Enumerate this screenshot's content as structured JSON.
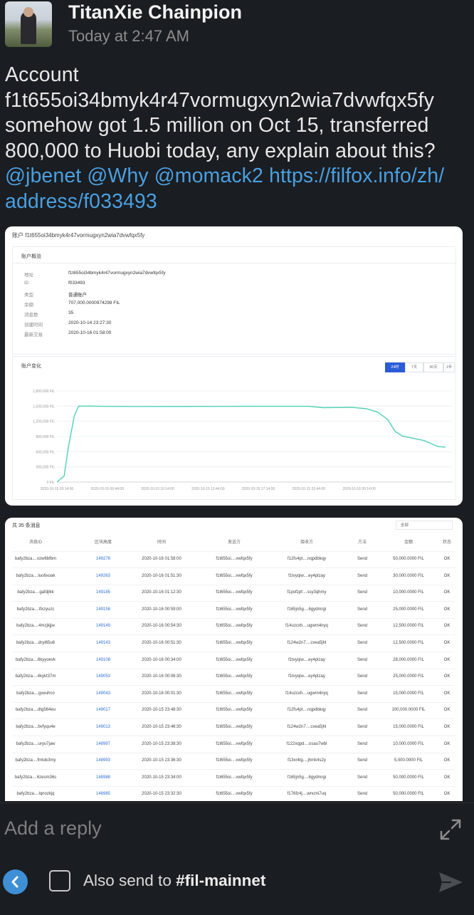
{
  "message": {
    "sender": "TitanXie Chainpion",
    "timestamp": "Today at 2:47 AM",
    "lines": [
      "Account",
      "f1t655oi34bmyk4r47vormugxyn2wia7dvwfqx5fy",
      "somehow got 1.5 million on Oct 15, transferred",
      "800,000 to Huobi today, any explain about this?"
    ],
    "mentions": [
      "@jbenet",
      "@Why",
      "@momack2"
    ],
    "link_part1": "https://filfox.info/zh/",
    "link_part2": "address/f033493"
  },
  "screenshot": {
    "title": "账户 f1t655oi34bmyk4r47vormugxyn2wia7dvwfqx5fy",
    "overview": {
      "heading": "账户概览",
      "rows": [
        {
          "key": "地址",
          "value": "f1t655oi34bmyk4r47vormugxyn2wia7dvwfqx5fy"
        },
        {
          "key": "ID",
          "value": "f033493"
        },
        {
          "key": "类型",
          "value": "普通账户"
        },
        {
          "key": "余额",
          "value": "707,000.0000974298 FIL"
        },
        {
          "key": "消息数",
          "value": "35"
        },
        {
          "key": "创建时间",
          "value": "2020-10-14 23:27:30"
        },
        {
          "key": "最新交易",
          "value": "2020-10-16 01:58:00"
        }
      ]
    },
    "chart_panel": {
      "heading": "账户变化",
      "ranges": [
        "24时",
        "7天",
        "30天",
        "1年"
      ],
      "active_range": "24时"
    },
    "table": {
      "title": "共 35 条消息",
      "filter": "全部",
      "headers": [
        "消息ID",
        "区块高度",
        "时间",
        "发送方",
        "接收方",
        "方法",
        "金额",
        "状态"
      ],
      "rows": [
        [
          "bafy2bza....vzw6bfbm",
          "149276",
          "2020-10-16 01:58:00",
          "f1t655oi....vwfqx5fy",
          "f12fs4pt....nqpdbkqy",
          "Send",
          "50,000.0000 FIL",
          "OK"
        ],
        [
          "bafy2bza....luo6xoak",
          "149263",
          "2020-10-16 01:51:30",
          "f1t655oi....vwfqx5fy",
          "f1tvyqiw....ey4plzay",
          "Send",
          "30,000.0000 FIL",
          "OK"
        ],
        [
          "bafy2bza....gafdjlkk",
          "149185",
          "2020-10-16 01:12:30",
          "f1t655oi....vwfqx5fy",
          "f1pofzpf....ssy3qhmy",
          "Send",
          "10,000.0000 FIL",
          "OK"
        ],
        [
          "bafy2bza....tfxzyuzc",
          "149158",
          "2020-10-16 00:59:00",
          "f1t655oi....vwfqx5fy",
          "f165jn5g....6gydmrgi",
          "Send",
          "25,000.0000 FIL",
          "OK"
        ],
        [
          "bafy2bza....4mzjkjjw",
          "149149",
          "2020-10-16 00:54:30",
          "f1t655oi....vwfqx5fy",
          "f14uzcxh....ugwm4nyq",
          "Send",
          "12,500.0000 FIL",
          "OK"
        ],
        [
          "bafy2bza....dryi65u6",
          "149143",
          "2020-10-16 00:51:30",
          "f1t655oi....vwfqx5fy",
          "f124w2n7....cxea5jhl",
          "Send",
          "12,500.0000 FIL",
          "OK"
        ],
        [
          "bafy2bza....6kyyoevk",
          "149108",
          "2020-10-16 00:34:00",
          "f1t655oi....vwfqx5fy",
          "f1tvyqiw....ey4plzay",
          "Send",
          "28,000.0000 FIL",
          "OK"
        ],
        [
          "bafy2bza....4kykt37m",
          "149053",
          "2020-10-16 00:06:30",
          "f1t655oi....vwfqx5fy",
          "f1tvyqiw....ey4plzay",
          "Send",
          "25,000.0000 FIL",
          "OK"
        ],
        [
          "bafy2bza....gxeuhco",
          "149043",
          "2020-10-16 00:01:30",
          "f1t655oi....vwfqx5fy",
          "f14uzcxh....ugwm4nyq",
          "Send",
          "15,000.0000 FIL",
          "OK"
        ],
        [
          "bafy2bza....dtg564eu",
          "149017",
          "2020-10-15 23:48:30",
          "f1t655oi....vwfqx5fy",
          "f12fs4pt....nqpdbkqy",
          "Send",
          "100,000.0000 FIL",
          "OK"
        ],
        [
          "bafy2bza....bvfyqu4e",
          "149013",
          "2020-10-15 23:46:30",
          "f1t655oi....vwfqx5fy",
          "f124w2n7....cxea5jhl",
          "Send",
          "15,000.0000 FIL",
          "OK"
        ],
        [
          "bafy2bza....uryu7jaw",
          "148997",
          "2020-10-15 23:38:30",
          "f1t655oi....vwfqx5fy",
          "f122xqpd....osau7wbl",
          "Send",
          "10,000.0000 FIL",
          "OK"
        ],
        [
          "bafy2bza....fmtok3my",
          "148993",
          "2020-10-15 23:36:30",
          "f1t655oi....vwfqx5fy",
          "f13xr4tg....jhmk4s2y",
          "Send",
          "5,000.0000 FIL",
          "OK"
        ],
        [
          "bafy2bza....6zesm36s",
          "148988",
          "2020-10-15 23:34:00",
          "f1t655oi....vwfqx5fy",
          "f165jn5g....6gydmrgi",
          "Send",
          "50,000.0000 FIL",
          "OK"
        ],
        [
          "bafy2bza....lqnozkjq",
          "148985",
          "2020-10-15 23:32:30",
          "f1t655oi....vwfqx5fy",
          "f176fz4j....wncmi7uq",
          "Send",
          "50,000.0000 FIL",
          "OK"
        ]
      ]
    }
  },
  "chart_data": {
    "type": "line",
    "title": "账户变化",
    "y_tick_labels": [
      "0 FIL",
      "300,000 FIL",
      "600,000 FIL",
      "900,000 FIL",
      "1,200,000 FIL",
      "1,500,000 FIL",
      "1,800,000 FIL"
    ],
    "x_tick_labels": [
      "2020-10-15 03:14:00",
      "2020-10-15 06:44:00",
      "2020-10-15 10:14:00",
      "2020-10-15 13:44:00",
      "2020-10-15 17:14:00",
      "2020-10-15 20:44:00",
      "2020-10-16 00:14:00"
    ],
    "ylim": [
      0,
      1800000
    ],
    "x_hours": [
      0,
      0.5,
      0.8,
      1.2,
      1.5,
      2.3,
      3.5,
      7,
      10.5,
      14,
      17.5,
      18.5,
      20.5,
      21.5,
      22.3,
      23.0,
      23.5,
      24.0,
      24.5,
      25.0,
      25.5,
      26.0,
      26.5,
      27.0
    ],
    "values": [
      0,
      120000,
      700000,
      1300000,
      1500000,
      1500000,
      1495000,
      1493000,
      1495000,
      1496000,
      1496000,
      1470000,
      1475000,
      1448000,
      1380000,
      1230000,
      1000000,
      910000,
      880000,
      850000,
      820000,
      760000,
      700000,
      690000
    ],
    "color": "#4fd1b8"
  },
  "reply": {
    "placeholder": "Add a reply",
    "also_send_prefix": "Also send to ",
    "channel": "#fil-mainnet"
  },
  "colors": {
    "background": "#1a1d21",
    "link": "#4a9fe0",
    "accent": "#3e8fd6"
  }
}
